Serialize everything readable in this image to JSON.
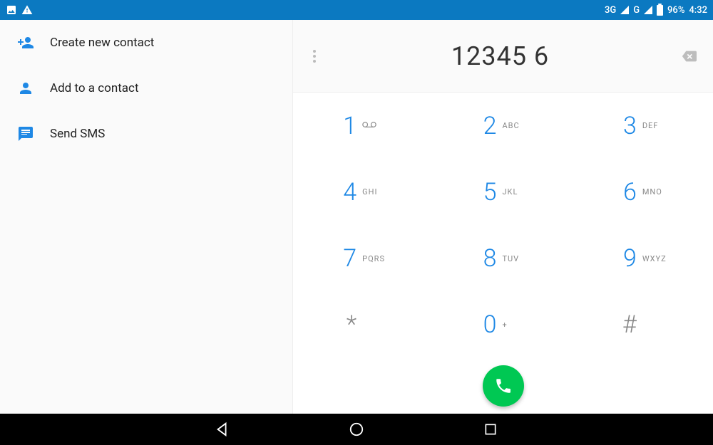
{
  "statusbar": {
    "network1": "3G",
    "network2": "G",
    "battery_pct": "96%",
    "time": "4:32"
  },
  "left_options": {
    "create": "Create new contact",
    "add": "Add to a contact",
    "sms": "Send SMS"
  },
  "dial": {
    "number": "12345 6"
  },
  "keys": {
    "k1": {
      "digit": "1",
      "letters": ""
    },
    "k2": {
      "digit": "2",
      "letters": "ABC"
    },
    "k3": {
      "digit": "3",
      "letters": "DEF"
    },
    "k4": {
      "digit": "4",
      "letters": "GHI"
    },
    "k5": {
      "digit": "5",
      "letters": "JKL"
    },
    "k6": {
      "digit": "6",
      "letters": "MNO"
    },
    "k7": {
      "digit": "7",
      "letters": "PQRS"
    },
    "k8": {
      "digit": "8",
      "letters": "TUV"
    },
    "k9": {
      "digit": "9",
      "letters": "WXYZ"
    },
    "kstar": {
      "digit": "*",
      "letters": ""
    },
    "k0": {
      "digit": "0",
      "letters": "+"
    },
    "khash": {
      "digit": "#",
      "letters": ""
    }
  }
}
